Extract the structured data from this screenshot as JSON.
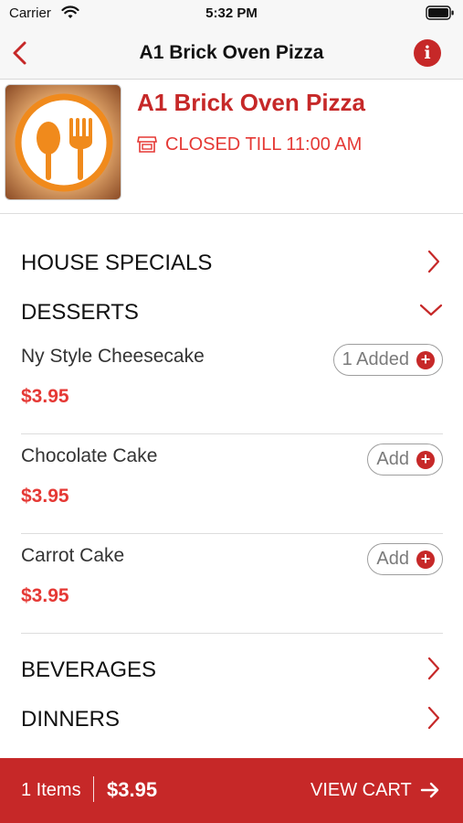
{
  "status_bar": {
    "carrier": "Carrier",
    "time": "5:32 PM"
  },
  "nav": {
    "title": "A1 Brick Oven Pizza"
  },
  "restaurant": {
    "name": "A1 Brick Oven Pizza",
    "status": "CLOSED TILL 11:00 AM"
  },
  "categories": {
    "house_specials": "HOUSE SPECIALS",
    "desserts": "DESSERTS",
    "beverages": "BEVERAGES",
    "dinners": "DINNERS"
  },
  "dessert_items": [
    {
      "name": "Ny Style Cheesecake",
      "price": "$3.95",
      "button": "1 Added"
    },
    {
      "name": "Chocolate Cake",
      "price": "$3.95",
      "button": "Add"
    },
    {
      "name": "Carrot Cake",
      "price": "$3.95",
      "button": "Add"
    }
  ],
  "cart": {
    "count": "1 Items",
    "total": "$3.95",
    "action": "VIEW CART"
  },
  "colors": {
    "brand_red": "#c62828",
    "price_red": "#e53935"
  },
  "icons": [
    "wifi-icon",
    "battery-icon",
    "back-chevron-icon",
    "info-icon",
    "restaurant-logo",
    "store-icon",
    "chevron-right-icon",
    "chevron-down-icon",
    "plus-icon",
    "arrow-right-icon"
  ]
}
